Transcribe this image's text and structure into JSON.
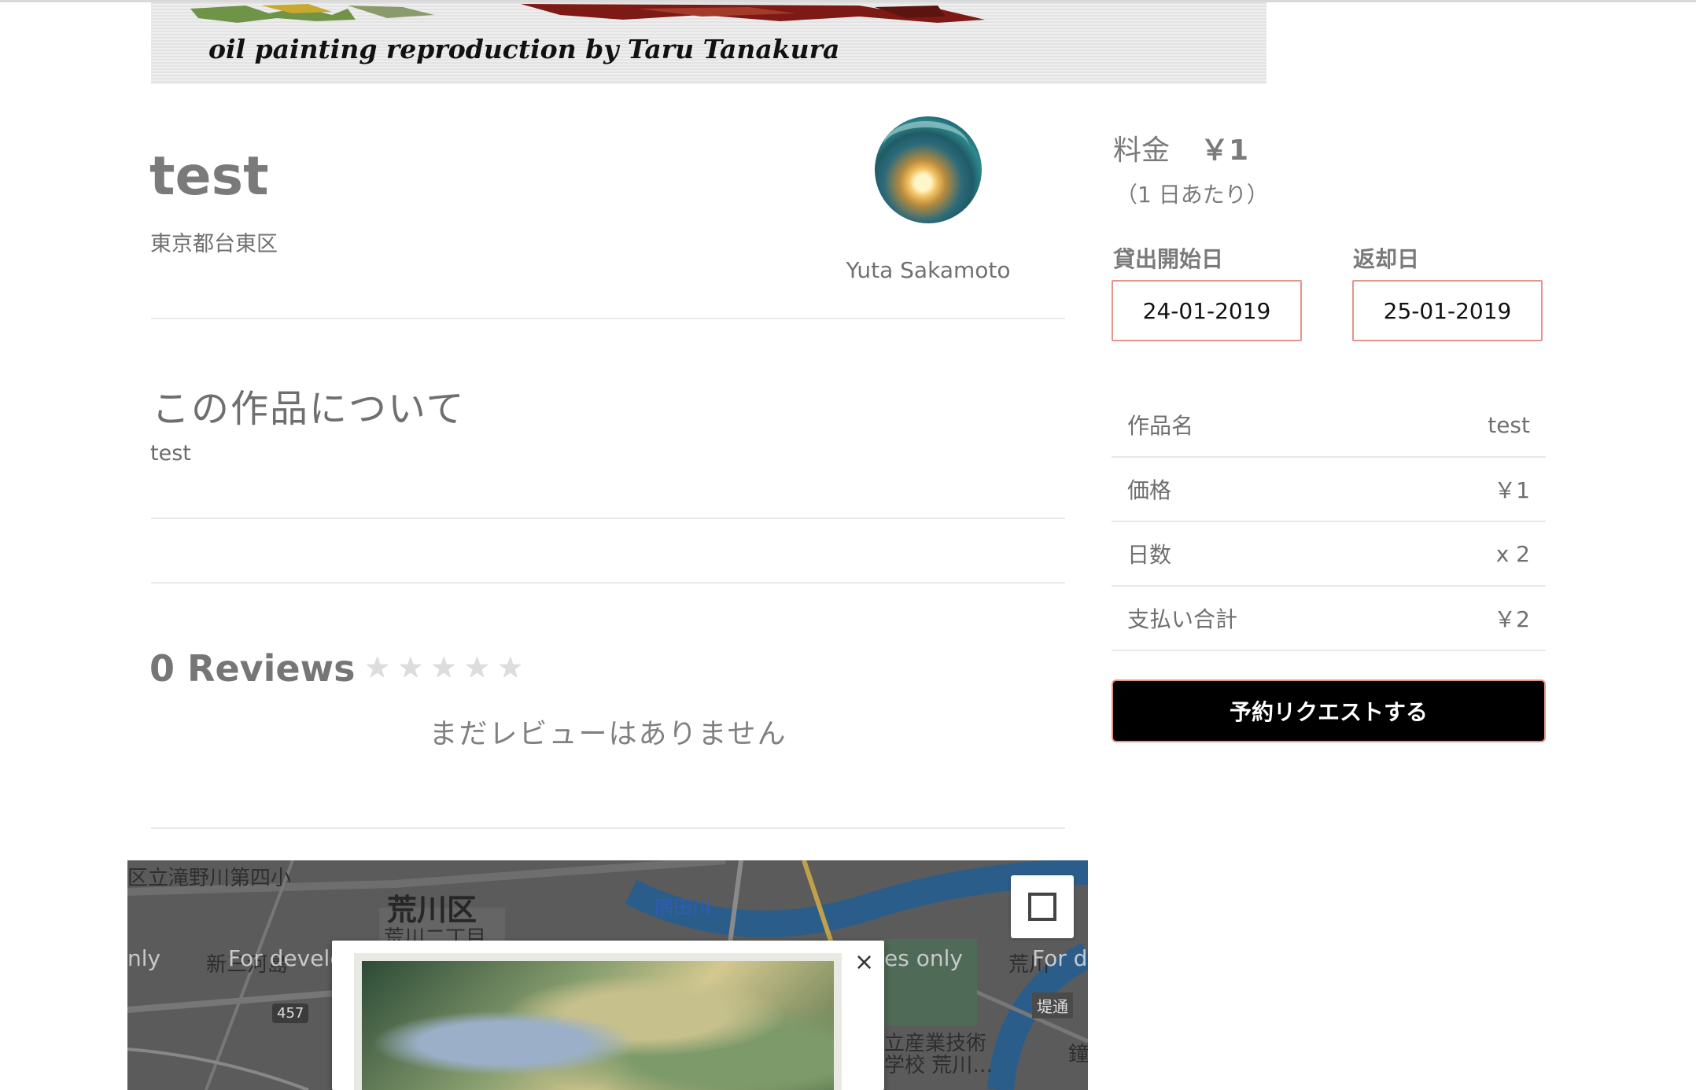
{
  "hero": {
    "caption": "oil painting reproduction by Taru Tanakura"
  },
  "listing": {
    "title": "test",
    "location": "東京都台東区"
  },
  "host": {
    "name": "Yuta Sakamoto"
  },
  "about": {
    "heading": "この作品について",
    "body": "test"
  },
  "reviews": {
    "title": "0 Reviews",
    "rating": 0,
    "max_rating": 5,
    "star_glyph": "★",
    "empty_message": "まだレビューはありません"
  },
  "booking": {
    "price_label": "料金",
    "price_value": "￥1",
    "price_unit": "（1 日あたり）",
    "start_label": "貸出開始日",
    "start_value": "24-01-2019",
    "end_label": "返却日",
    "end_value": "25-01-2019",
    "summary": [
      {
        "label": "作品名",
        "value": "test"
      },
      {
        "label": "価格",
        "value": "￥1"
      },
      {
        "label": "日数",
        "value": "x 2"
      },
      {
        "label": "支払い合計",
        "value": "￥2"
      }
    ],
    "reserve_label": "予約リクエストする"
  },
  "map": {
    "labels": {
      "school": "区立滝野川第四小",
      "ward": "荒川区",
      "district": "荒川二丁目",
      "river": "隅田川",
      "area1": "新三河島",
      "area2": "荒川",
      "tech": "立産業技術",
      "tech2": "学校 荒川…",
      "route": "457",
      "street": "堤通",
      "bell": "鐘",
      "dev1": "For develo",
      "dev2": "es only",
      "dev3": "For d",
      "dev4": "nly"
    },
    "popup_close": "×"
  },
  "colors": {
    "accent_border": "#e6938c",
    "button_bg": "#000000",
    "text_gray": "#7a7a7a"
  }
}
